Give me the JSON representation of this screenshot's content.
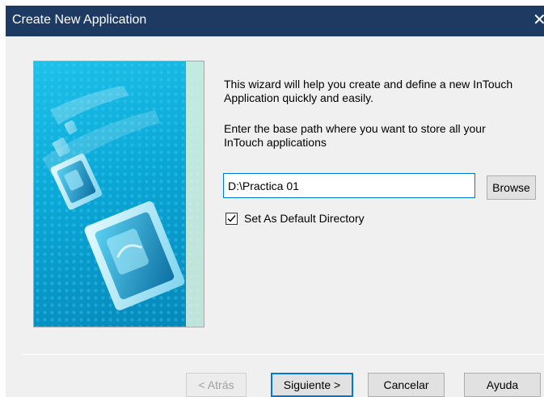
{
  "window": {
    "title": "Create New Application",
    "close_glyph": "✕"
  },
  "wizard": {
    "image_icon": "intouch-wizard-graphic",
    "intro_text": "This wizard will help you create and define a new InTouch Application quickly and easily.",
    "path_prompt": "Enter the base path where you want to store all your InTouch applications",
    "path_value": "D:\\Practica 01",
    "browse_label": "Browse",
    "default_dir_label": "Set As Default Directory",
    "default_dir_checked": true
  },
  "footer": {
    "back_label": "< Atrás",
    "next_label": "Siguiente >",
    "cancel_label": "Cancelar",
    "help_label": "Ayuda"
  },
  "colors": {
    "titlebar": "#1d3a63",
    "client_bg": "#f0f0f0",
    "focus_accent": "#0078d7"
  }
}
